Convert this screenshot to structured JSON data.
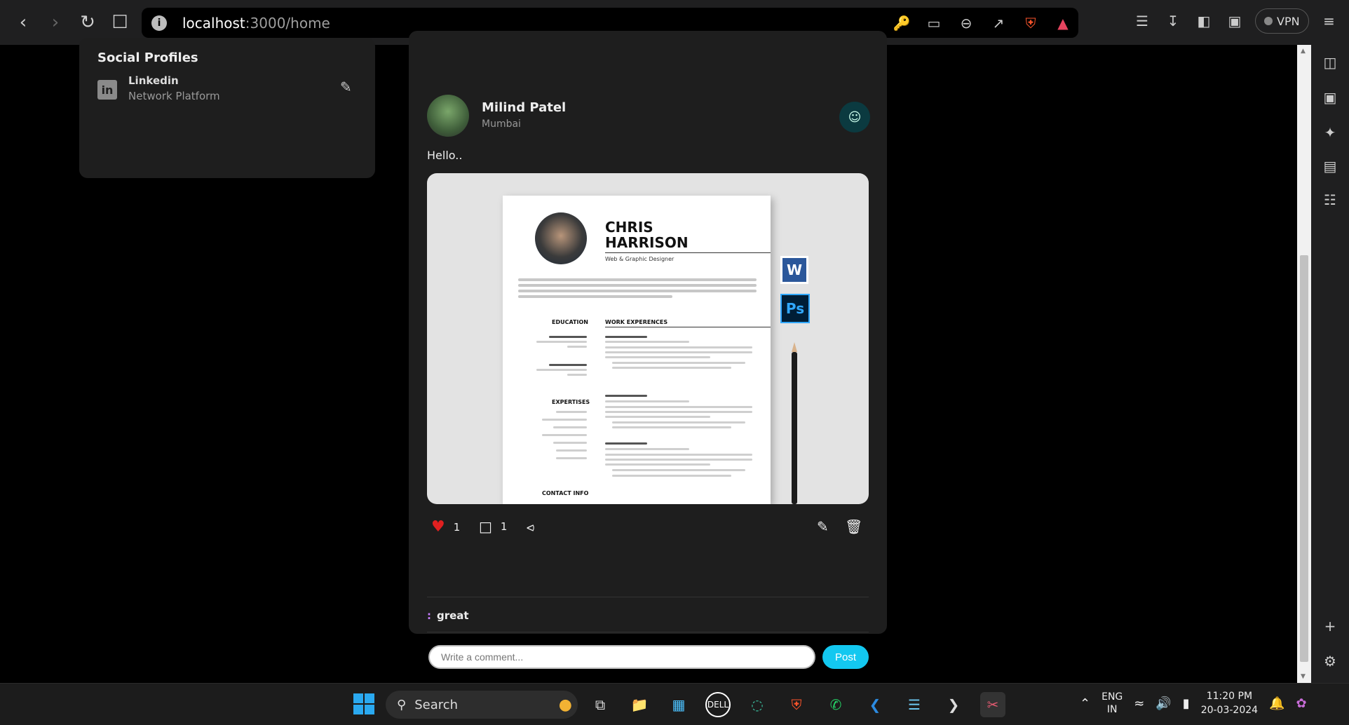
{
  "browser": {
    "url_host": "localhost",
    "url_path": ":3000/home",
    "vpn_label": "VPN",
    "nav_icons": [
      "back-icon",
      "forward-icon",
      "reload-icon",
      "bookmark-icon"
    ],
    "url_icons": [
      "key-icon",
      "cast-icon",
      "zoom-out-icon",
      "share-icon",
      "brave-shield-icon",
      "brave-rewards-icon"
    ],
    "tool_icons": [
      "extensions-icon",
      "download-icon",
      "sidebar-icon",
      "wallet-icon"
    ],
    "menu_icon": "hamburger-menu-icon"
  },
  "sidepanel_icons": [
    "media-icon",
    "wallet-icon",
    "leo-ai-icon",
    "bookmarks-icon",
    "reading-list-icon",
    "add-icon",
    "settings-icon"
  ],
  "profile_card": {
    "title": "Social Profiles",
    "item_name": "Linkedin",
    "item_sub": "Network Platform"
  },
  "post": {
    "author": "Milind Patel",
    "location": "Mumbai",
    "text": "Hello..",
    "likes": "1",
    "comments": "1",
    "comment_text": "great",
    "comment_placeholder": "Write a comment...",
    "post_label": "Post",
    "image": {
      "name_line1": "CHRIS",
      "name_line2": "HARRISON",
      "role": "Web & Graphic Designer",
      "education": "EDUCATION",
      "work": "WORK EXPERENCES",
      "expertises": "EXPERTISES",
      "contact": "CONTACT INFO",
      "word_label": "W",
      "ps_label": "Ps"
    }
  },
  "taskbar": {
    "search_label": "Search",
    "lang_line1": "ENG",
    "lang_line2": "IN",
    "time": "11:20 PM",
    "date": "20-03-2024"
  }
}
